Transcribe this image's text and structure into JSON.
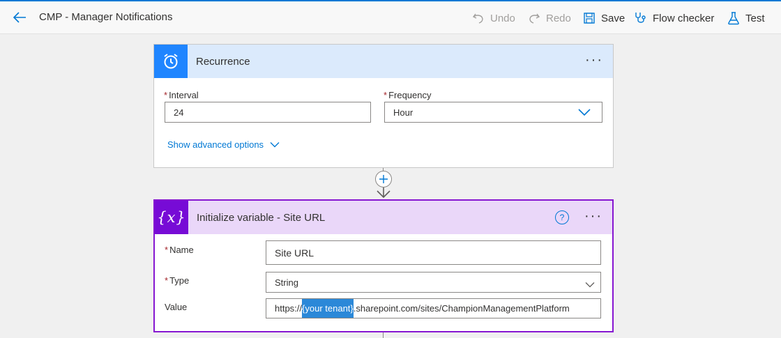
{
  "header": {
    "title": "CMP - Manager Notifications",
    "commands": {
      "undo": "Undo",
      "redo": "Redo",
      "save": "Save",
      "flow_checker": "Flow checker",
      "test": "Test"
    }
  },
  "recurrence": {
    "title": "Recurrence",
    "more": "···",
    "interval_label": "Interval",
    "interval_value": "24",
    "frequency_label": "Frequency",
    "frequency_value": "Hour",
    "required_mark": "*",
    "advanced_link": "Show advanced options"
  },
  "init_variable": {
    "title": "Initialize variable - Site URL",
    "more": "···",
    "name_label": "Name",
    "name_value": "Site URL",
    "type_label": "Type",
    "type_value": "String",
    "value_label": "Value",
    "value_prefix": "https://",
    "value_selected": "{your tenant}",
    "value_suffix": ".sharepoint.com/sites/ChampionManagementPlatform",
    "required_mark": "*"
  },
  "colors": {
    "accent": "#0078d4",
    "recurrence_header": "#dbeafc",
    "recurrence_icon_bg": "#1f85ff",
    "variable_header": "#ead7f9",
    "variable_icon_bg": "#770bd6",
    "variable_border": "#8616d1"
  },
  "icons": {
    "back": "back-arrow-icon",
    "undo": "undo-icon",
    "redo": "redo-icon",
    "save": "save-icon",
    "flow_checker": "stethoscope-icon",
    "test": "flask-icon",
    "recurrence": "alarm-clock-icon",
    "variable": "variable-x-icon",
    "help": "help-circle-icon",
    "chevron": "chevron-down-icon",
    "add": "plus-icon"
  }
}
